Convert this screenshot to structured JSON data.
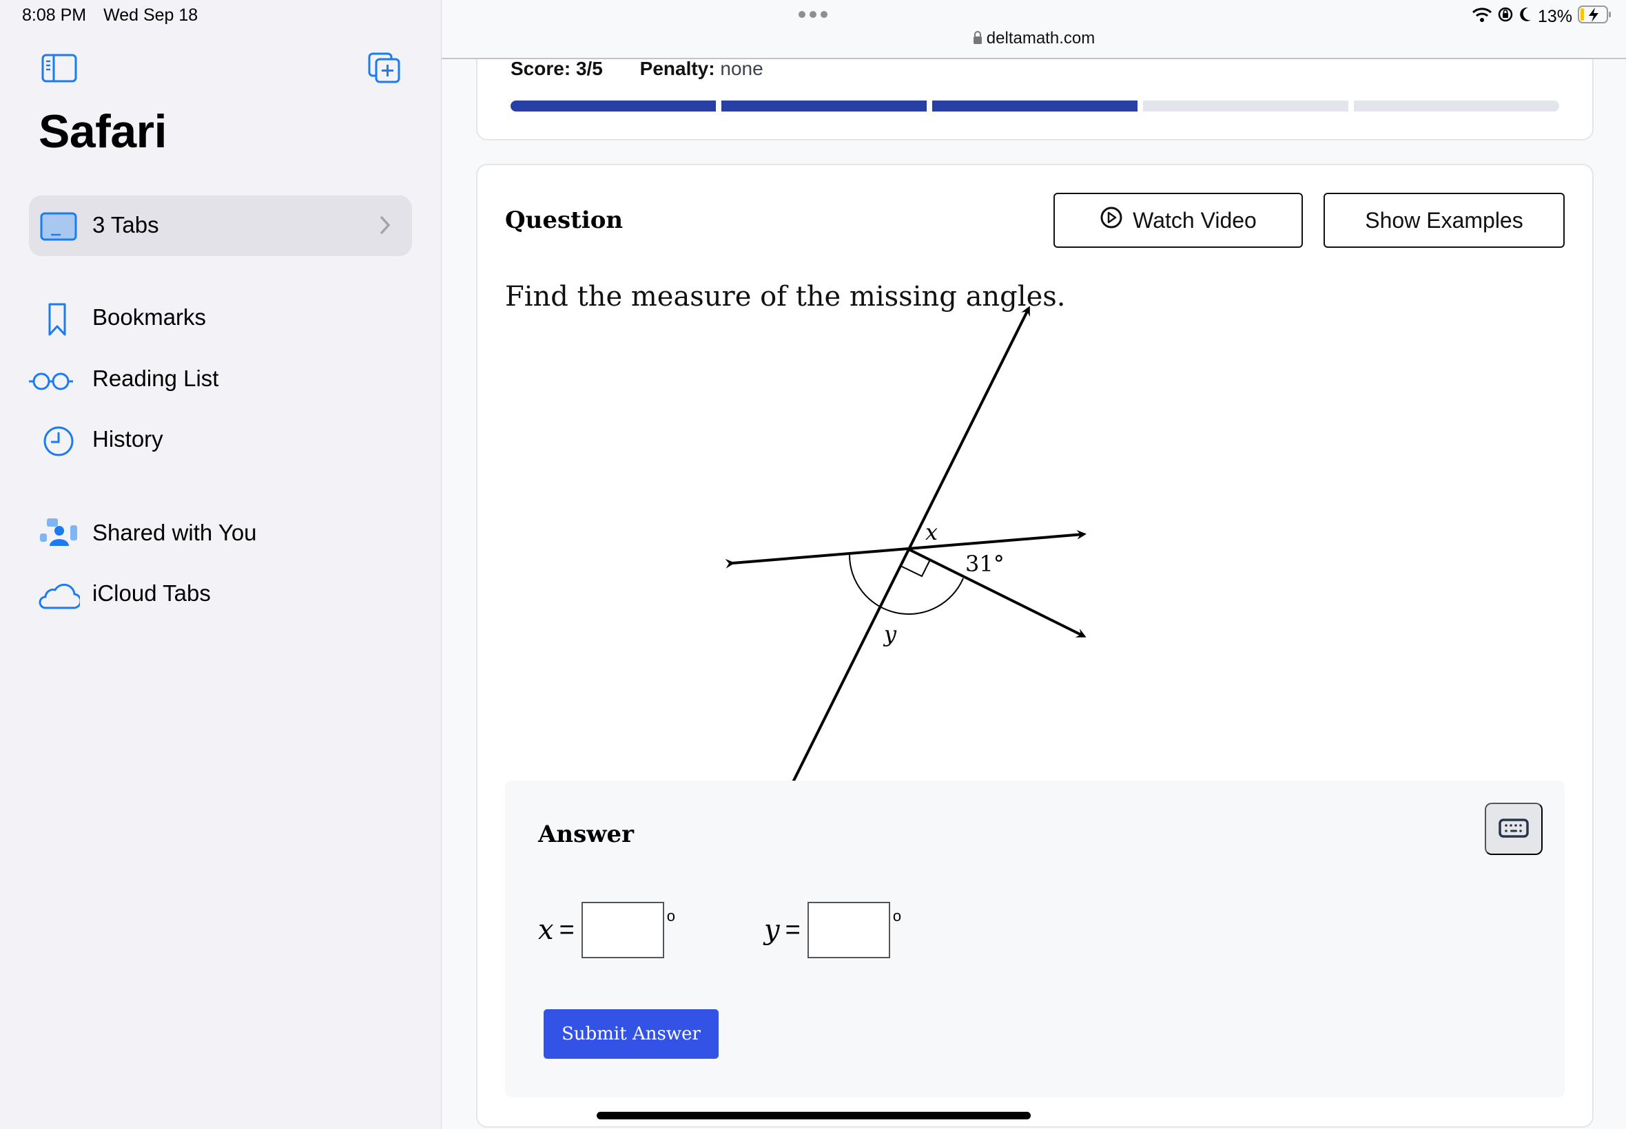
{
  "status_bar": {
    "time": "8:08 PM",
    "date": "Wed Sep 18",
    "battery_percent": "13%",
    "icons": [
      "wifi-icon",
      "orientation-lock-icon",
      "moon-icon",
      "battery-charging-icon"
    ]
  },
  "sidebar": {
    "title": "Safari",
    "toggle_icon": "sidebar-toggle-icon",
    "new_tab_icon": "new-tab-group-icon",
    "tabs_item": {
      "label": "3 Tabs",
      "icon": "tabs-icon"
    },
    "items": [
      {
        "label": "Bookmarks",
        "icon": "bookmark-icon"
      },
      {
        "label": "Reading List",
        "icon": "glasses-icon"
      },
      {
        "label": "History",
        "icon": "clock-icon"
      },
      {
        "label": "Shared with You",
        "icon": "shared-with-you-icon"
      },
      {
        "label": "iCloud Tabs",
        "icon": "cloud-icon"
      }
    ]
  },
  "browser": {
    "url": "deltamath.com",
    "secure": true
  },
  "score": {
    "score_label": "Score:",
    "score_value": "3/5",
    "penalty_label": "Penalty:",
    "penalty_value": "none",
    "progress_completed": 3,
    "progress_total": 5
  },
  "question": {
    "heading": "Question",
    "watch_video_label": "Watch Video",
    "show_examples_label": "Show Examples",
    "prompt": "Find the measure of the missing angles.",
    "diagram": {
      "labels": {
        "x": "x",
        "y": "y",
        "given_angle": "31°"
      },
      "right_angle_marked": true
    }
  },
  "answer": {
    "heading": "Answer",
    "fields": [
      {
        "variable": "x",
        "equals": "=",
        "value": "",
        "unit": "o"
      },
      {
        "variable": "y",
        "equals": "=",
        "value": "",
        "unit": "o"
      }
    ],
    "submit_label": "Submit Answer",
    "keyboard_icon": "keyboard-icon"
  },
  "colors": {
    "accent_blue": "#3253e6",
    "progress_done": "#2740a6",
    "progress_todo": "#e2e6ec",
    "ios_blue": "#1a7cf0"
  }
}
